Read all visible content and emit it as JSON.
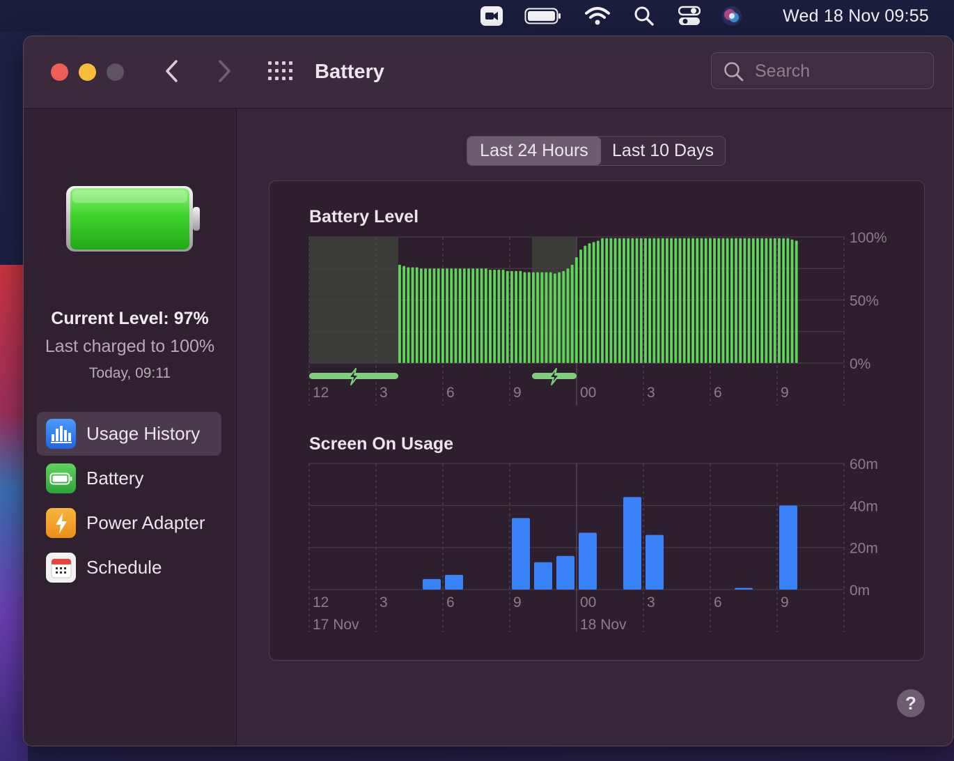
{
  "menubar": {
    "clock": "Wed 18 Nov  09:55",
    "icons": [
      "facetime-icon",
      "battery-icon",
      "wifi-icon",
      "search-icon",
      "control-center-icon",
      "siri-icon"
    ]
  },
  "window": {
    "title": "Battery",
    "search_placeholder": "Search"
  },
  "sidebar": {
    "current_level": "Current Level: 97%",
    "last_charged": "Last charged to 100%",
    "charged_time": "Today, 09:11",
    "items": [
      {
        "label": "Usage History",
        "icon": "usage-history-icon",
        "color": "#2f7cf6",
        "active": true
      },
      {
        "label": "Battery",
        "icon": "battery-icon",
        "color": "#3fbf4f",
        "active": false
      },
      {
        "label": "Power Adapter",
        "icon": "power-adapter-icon",
        "color": "#f4a12b",
        "active": false
      },
      {
        "label": "Schedule",
        "icon": "calendar-icon",
        "color": "#ececec",
        "active": false
      }
    ]
  },
  "tabs": [
    {
      "label": "Last 24 Hours",
      "selected": true
    },
    {
      "label": "Last 10 Days",
      "selected": false
    }
  ],
  "chart_data": [
    {
      "type": "bar",
      "title": "Battery Level",
      "color": "#5fd35a",
      "x_ticks": [
        "12",
        "3",
        "6",
        "9",
        "00",
        "3",
        "6",
        "9"
      ],
      "y_ticks": [
        "100%",
        "50%",
        "0%"
      ],
      "ylim": [
        0,
        100
      ],
      "grid": true,
      "charging_periods": [
        [
          0,
          4
        ],
        [
          10,
          12
        ]
      ],
      "values": [
        78,
        77,
        76,
        76,
        76,
        75,
        75,
        75,
        75,
        75,
        75,
        75,
        75,
        75,
        75,
        75,
        75,
        75,
        75,
        75,
        75,
        74,
        74,
        74,
        74,
        73,
        73,
        73,
        73,
        72,
        72,
        72,
        72,
        72,
        72,
        72,
        71,
        72,
        73,
        75,
        78,
        84,
        90,
        93,
        95,
        96,
        97,
        99,
        99,
        99,
        99,
        99,
        99,
        99,
        99,
        99,
        99,
        99,
        99,
        99,
        99,
        99,
        99,
        99,
        99,
        99,
        99,
        99,
        99,
        99,
        99,
        99,
        99,
        99,
        99,
        99,
        99,
        99,
        99,
        99,
        99,
        99,
        99,
        99,
        99,
        99,
        99,
        99,
        99,
        99,
        99,
        98,
        97
      ]
    },
    {
      "type": "bar",
      "title": "Screen On Usage",
      "color": "#3a82f7",
      "x_ticks": [
        "12",
        "3",
        "6",
        "9",
        "00",
        "3",
        "6",
        "9"
      ],
      "date_labels": [
        "17 Nov",
        "18 Nov"
      ],
      "y_ticks": [
        "60m",
        "40m",
        "20m",
        "0m"
      ],
      "ylim": [
        0,
        60
      ],
      "grid": true,
      "values": [
        0,
        0,
        0,
        0,
        0,
        5,
        7,
        0,
        0,
        34,
        13,
        16,
        27,
        0,
        44,
        26,
        0,
        0,
        0,
        0.8,
        0,
        40,
        0,
        0
      ]
    }
  ]
}
